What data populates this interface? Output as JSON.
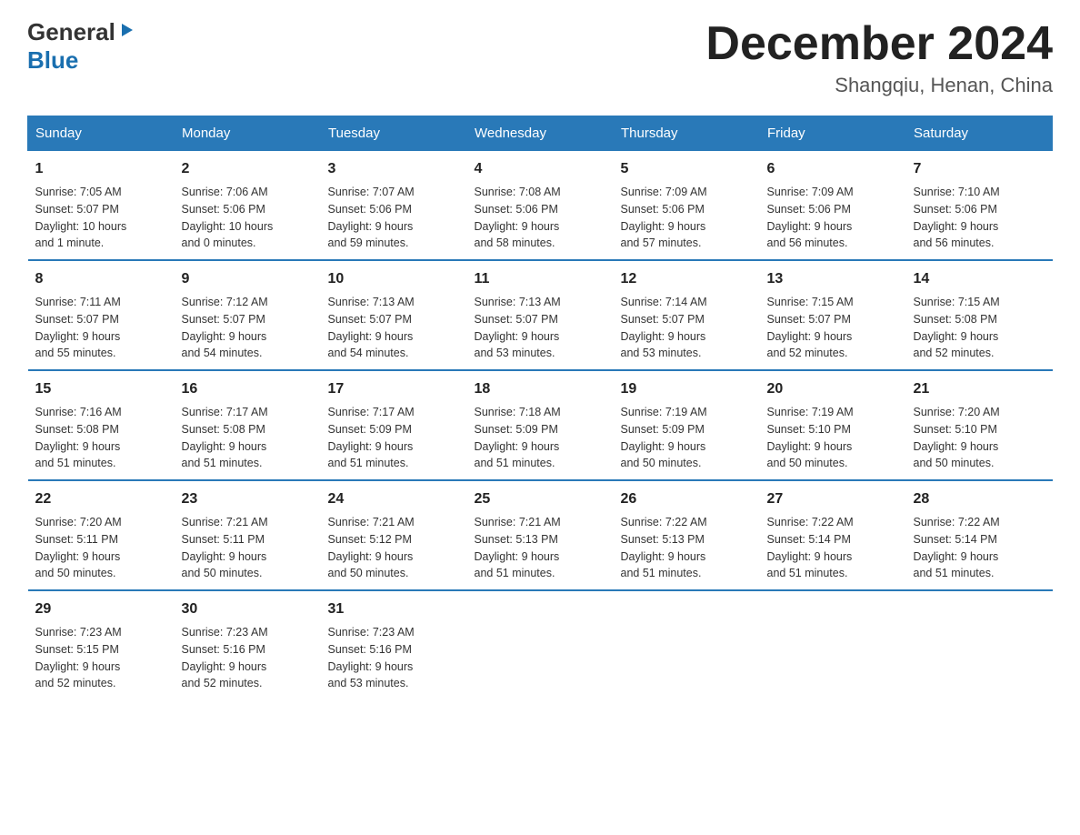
{
  "logo": {
    "general": "General",
    "arrow": "▶",
    "blue": "Blue"
  },
  "header": {
    "month": "December 2024",
    "location": "Shangqiu, Henan, China"
  },
  "weekdays": [
    "Sunday",
    "Monday",
    "Tuesday",
    "Wednesday",
    "Thursday",
    "Friday",
    "Saturday"
  ],
  "weeks": [
    [
      {
        "day": "1",
        "sunrise": "7:05 AM",
        "sunset": "5:07 PM",
        "daylight": "10 hours and 1 minute."
      },
      {
        "day": "2",
        "sunrise": "7:06 AM",
        "sunset": "5:06 PM",
        "daylight": "10 hours and 0 minutes."
      },
      {
        "day": "3",
        "sunrise": "7:07 AM",
        "sunset": "5:06 PM",
        "daylight": "9 hours and 59 minutes."
      },
      {
        "day": "4",
        "sunrise": "7:08 AM",
        "sunset": "5:06 PM",
        "daylight": "9 hours and 58 minutes."
      },
      {
        "day": "5",
        "sunrise": "7:09 AM",
        "sunset": "5:06 PM",
        "daylight": "9 hours and 57 minutes."
      },
      {
        "day": "6",
        "sunrise": "7:09 AM",
        "sunset": "5:06 PM",
        "daylight": "9 hours and 56 minutes."
      },
      {
        "day": "7",
        "sunrise": "7:10 AM",
        "sunset": "5:06 PM",
        "daylight": "9 hours and 56 minutes."
      }
    ],
    [
      {
        "day": "8",
        "sunrise": "7:11 AM",
        "sunset": "5:07 PM",
        "daylight": "9 hours and 55 minutes."
      },
      {
        "day": "9",
        "sunrise": "7:12 AM",
        "sunset": "5:07 PM",
        "daylight": "9 hours and 54 minutes."
      },
      {
        "day": "10",
        "sunrise": "7:13 AM",
        "sunset": "5:07 PM",
        "daylight": "9 hours and 54 minutes."
      },
      {
        "day": "11",
        "sunrise": "7:13 AM",
        "sunset": "5:07 PM",
        "daylight": "9 hours and 53 minutes."
      },
      {
        "day": "12",
        "sunrise": "7:14 AM",
        "sunset": "5:07 PM",
        "daylight": "9 hours and 53 minutes."
      },
      {
        "day": "13",
        "sunrise": "7:15 AM",
        "sunset": "5:07 PM",
        "daylight": "9 hours and 52 minutes."
      },
      {
        "day": "14",
        "sunrise": "7:15 AM",
        "sunset": "5:08 PM",
        "daylight": "9 hours and 52 minutes."
      }
    ],
    [
      {
        "day": "15",
        "sunrise": "7:16 AM",
        "sunset": "5:08 PM",
        "daylight": "9 hours and 51 minutes."
      },
      {
        "day": "16",
        "sunrise": "7:17 AM",
        "sunset": "5:08 PM",
        "daylight": "9 hours and 51 minutes."
      },
      {
        "day": "17",
        "sunrise": "7:17 AM",
        "sunset": "5:09 PM",
        "daylight": "9 hours and 51 minutes."
      },
      {
        "day": "18",
        "sunrise": "7:18 AM",
        "sunset": "5:09 PM",
        "daylight": "9 hours and 51 minutes."
      },
      {
        "day": "19",
        "sunrise": "7:19 AM",
        "sunset": "5:09 PM",
        "daylight": "9 hours and 50 minutes."
      },
      {
        "day": "20",
        "sunrise": "7:19 AM",
        "sunset": "5:10 PM",
        "daylight": "9 hours and 50 minutes."
      },
      {
        "day": "21",
        "sunrise": "7:20 AM",
        "sunset": "5:10 PM",
        "daylight": "9 hours and 50 minutes."
      }
    ],
    [
      {
        "day": "22",
        "sunrise": "7:20 AM",
        "sunset": "5:11 PM",
        "daylight": "9 hours and 50 minutes."
      },
      {
        "day": "23",
        "sunrise": "7:21 AM",
        "sunset": "5:11 PM",
        "daylight": "9 hours and 50 minutes."
      },
      {
        "day": "24",
        "sunrise": "7:21 AM",
        "sunset": "5:12 PM",
        "daylight": "9 hours and 50 minutes."
      },
      {
        "day": "25",
        "sunrise": "7:21 AM",
        "sunset": "5:13 PM",
        "daylight": "9 hours and 51 minutes."
      },
      {
        "day": "26",
        "sunrise": "7:22 AM",
        "sunset": "5:13 PM",
        "daylight": "9 hours and 51 minutes."
      },
      {
        "day": "27",
        "sunrise": "7:22 AM",
        "sunset": "5:14 PM",
        "daylight": "9 hours and 51 minutes."
      },
      {
        "day": "28",
        "sunrise": "7:22 AM",
        "sunset": "5:14 PM",
        "daylight": "9 hours and 51 minutes."
      }
    ],
    [
      {
        "day": "29",
        "sunrise": "7:23 AM",
        "sunset": "5:15 PM",
        "daylight": "9 hours and 52 minutes."
      },
      {
        "day": "30",
        "sunrise": "7:23 AM",
        "sunset": "5:16 PM",
        "daylight": "9 hours and 52 minutes."
      },
      {
        "day": "31",
        "sunrise": "7:23 AM",
        "sunset": "5:16 PM",
        "daylight": "9 hours and 53 minutes."
      },
      {
        "day": "",
        "sunrise": "",
        "sunset": "",
        "daylight": ""
      },
      {
        "day": "",
        "sunrise": "",
        "sunset": "",
        "daylight": ""
      },
      {
        "day": "",
        "sunrise": "",
        "sunset": "",
        "daylight": ""
      },
      {
        "day": "",
        "sunrise": "",
        "sunset": "",
        "daylight": ""
      }
    ]
  ]
}
